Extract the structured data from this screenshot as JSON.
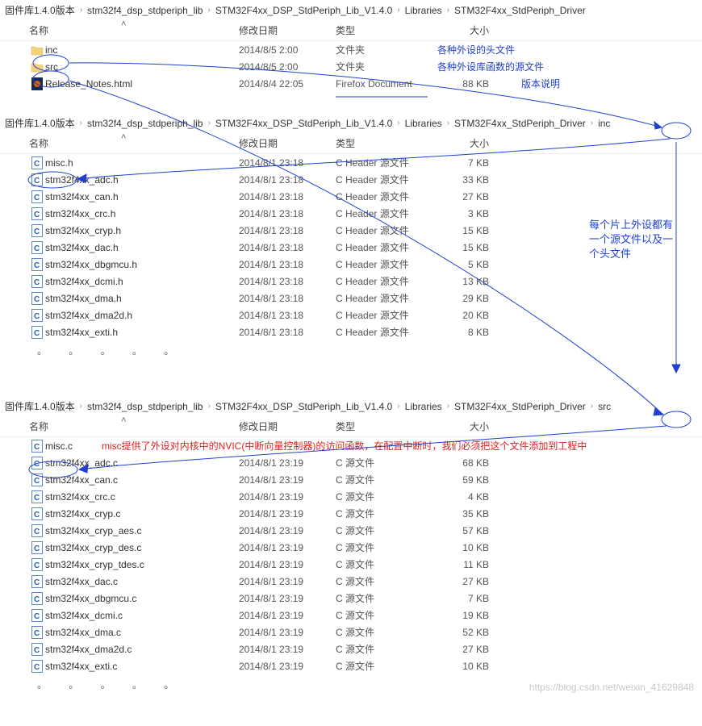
{
  "headers": {
    "name": "名称",
    "date": "修改日期",
    "type": "类型",
    "size": "大小"
  },
  "dots": "。 。 。 。 。",
  "annotations": {
    "row0_inc": "各种外设的头文件",
    "row0_src": "各种外设库函数的源文件",
    "row0_release": "版本说明",
    "side_inc": "每个片上外设都有一个源文件以及一个头文件",
    "misc_note": "misc提供了外设对内核中的NVIC(中断向量控制器)的访问函数，在配置中断时，我们必须把这个文件添加到工程中"
  },
  "watermark": "https://blog.csdn.net/weixin_41629848",
  "panel0": {
    "crumbs": [
      "固件库1.4.0版本",
      "stm32f4_dsp_stdperiph_lib",
      "STM32F4xx_DSP_StdPeriph_Lib_V1.4.0",
      "Libraries",
      "STM32F4xx_StdPeriph_Driver"
    ],
    "rows": [
      {
        "icon": "folder",
        "name": "inc",
        "date": "2014/8/5 2:00",
        "type": "文件夹",
        "size": ""
      },
      {
        "icon": "folder",
        "name": "src",
        "date": "2014/8/5 2:00",
        "type": "文件夹",
        "size": ""
      },
      {
        "icon": "ff",
        "name": "Release_Notes.html",
        "date": "2014/8/4 22:05",
        "type": "Firefox Document",
        "size": "88 KB"
      }
    ]
  },
  "panel1": {
    "crumbs": [
      "固件库1.4.0版本",
      "stm32f4_dsp_stdperiph_lib",
      "STM32F4xx_DSP_StdPeriph_Lib_V1.4.0",
      "Libraries",
      "STM32F4xx_StdPeriph_Driver",
      "inc"
    ],
    "rows": [
      {
        "icon": "c",
        "name": "misc.h",
        "date": "2014/8/1 23:18",
        "type": "C Header 源文件",
        "size": "7 KB"
      },
      {
        "icon": "c",
        "name": "stm32f4xx_adc.h",
        "date": "2014/8/1 23:18",
        "type": "C Header 源文件",
        "size": "33 KB"
      },
      {
        "icon": "c",
        "name": "stm32f4xx_can.h",
        "date": "2014/8/1 23:18",
        "type": "C Header 源文件",
        "size": "27 KB"
      },
      {
        "icon": "c",
        "name": "stm32f4xx_crc.h",
        "date": "2014/8/1 23:18",
        "type": "C Header 源文件",
        "size": "3 KB"
      },
      {
        "icon": "c",
        "name": "stm32f4xx_cryp.h",
        "date": "2014/8/1 23:18",
        "type": "C Header 源文件",
        "size": "15 KB"
      },
      {
        "icon": "c",
        "name": "stm32f4xx_dac.h",
        "date": "2014/8/1 23:18",
        "type": "C Header 源文件",
        "size": "15 KB"
      },
      {
        "icon": "c",
        "name": "stm32f4xx_dbgmcu.h",
        "date": "2014/8/1 23:18",
        "type": "C Header 源文件",
        "size": "5 KB"
      },
      {
        "icon": "c",
        "name": "stm32f4xx_dcmi.h",
        "date": "2014/8/1 23:18",
        "type": "C Header 源文件",
        "size": "13 KB"
      },
      {
        "icon": "c",
        "name": "stm32f4xx_dma.h",
        "date": "2014/8/1 23:18",
        "type": "C Header 源文件",
        "size": "29 KB"
      },
      {
        "icon": "c",
        "name": "stm32f4xx_dma2d.h",
        "date": "2014/8/1 23:18",
        "type": "C Header 源文件",
        "size": "20 KB"
      },
      {
        "icon": "c",
        "name": "stm32f4xx_exti.h",
        "date": "2014/8/1 23:18",
        "type": "C Header 源文件",
        "size": "8 KB"
      }
    ]
  },
  "panel2": {
    "crumbs": [
      "固件库1.4.0版本",
      "stm32f4_dsp_stdperiph_lib",
      "STM32F4xx_DSP_StdPeriph_Lib_V1.4.0",
      "Libraries",
      "STM32F4xx_StdPeriph_Driver",
      "src"
    ],
    "rows": [
      {
        "icon": "c",
        "name": "misc.c",
        "date": "",
        "type": "",
        "size": ""
      },
      {
        "icon": "c",
        "name": "stm32f4xx_adc.c",
        "date": "2014/8/1 23:19",
        "type": "C 源文件",
        "size": "68 KB"
      },
      {
        "icon": "c",
        "name": "stm32f4xx_can.c",
        "date": "2014/8/1 23:19",
        "type": "C 源文件",
        "size": "59 KB"
      },
      {
        "icon": "c",
        "name": "stm32f4xx_crc.c",
        "date": "2014/8/1 23:19",
        "type": "C 源文件",
        "size": "4 KB"
      },
      {
        "icon": "c",
        "name": "stm32f4xx_cryp.c",
        "date": "2014/8/1 23:19",
        "type": "C 源文件",
        "size": "35 KB"
      },
      {
        "icon": "c",
        "name": "stm32f4xx_cryp_aes.c",
        "date": "2014/8/1 23:19",
        "type": "C 源文件",
        "size": "57 KB"
      },
      {
        "icon": "c",
        "name": "stm32f4xx_cryp_des.c",
        "date": "2014/8/1 23:19",
        "type": "C 源文件",
        "size": "10 KB"
      },
      {
        "icon": "c",
        "name": "stm32f4xx_cryp_tdes.c",
        "date": "2014/8/1 23:19",
        "type": "C 源文件",
        "size": "11 KB"
      },
      {
        "icon": "c",
        "name": "stm32f4xx_dac.c",
        "date": "2014/8/1 23:19",
        "type": "C 源文件",
        "size": "27 KB"
      },
      {
        "icon": "c",
        "name": "stm32f4xx_dbgmcu.c",
        "date": "2014/8/1 23:19",
        "type": "C 源文件",
        "size": "7 KB"
      },
      {
        "icon": "c",
        "name": "stm32f4xx_dcmi.c",
        "date": "2014/8/1 23:19",
        "type": "C 源文件",
        "size": "19 KB"
      },
      {
        "icon": "c",
        "name": "stm32f4xx_dma.c",
        "date": "2014/8/1 23:19",
        "type": "C 源文件",
        "size": "52 KB"
      },
      {
        "icon": "c",
        "name": "stm32f4xx_dma2d.c",
        "date": "2014/8/1 23:19",
        "type": "C 源文件",
        "size": "27 KB"
      },
      {
        "icon": "c",
        "name": "stm32f4xx_exti.c",
        "date": "2014/8/1 23:19",
        "type": "C 源文件",
        "size": "10 KB"
      }
    ]
  }
}
